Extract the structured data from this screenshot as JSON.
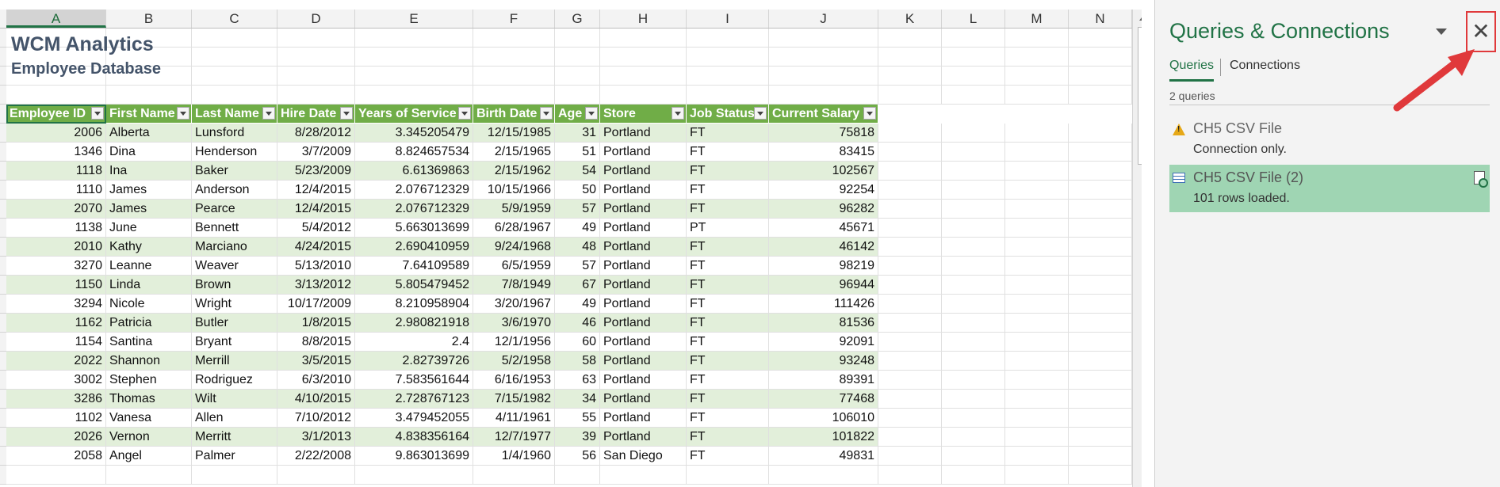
{
  "columns": [
    "A",
    "B",
    "C",
    "D",
    "E",
    "F",
    "G",
    "H",
    "I",
    "J",
    "K",
    "L",
    "M",
    "N"
  ],
  "title": "WCM Analytics",
  "subtitle": "Employee Database",
  "table": {
    "headers": [
      "Employee ID",
      "First Name",
      "Last Name",
      "Hire Date",
      "Years of Service",
      "Birth Date",
      "Age",
      "Store",
      "Job Status",
      "Current Salary"
    ],
    "rows": [
      [
        "2006",
        "Alberta",
        "Lunsford",
        "8/28/2012",
        "3.345205479",
        "12/15/1985",
        "31",
        "Portland",
        "FT",
        "75818"
      ],
      [
        "1346",
        "Dina",
        "Henderson",
        "3/7/2009",
        "8.824657534",
        "2/15/1965",
        "51",
        "Portland",
        "FT",
        "83415"
      ],
      [
        "1118",
        "Ina",
        "Baker",
        "5/23/2009",
        "6.61369863",
        "2/15/1962",
        "54",
        "Portland",
        "FT",
        "102567"
      ],
      [
        "1110",
        "James",
        "Anderson",
        "12/4/2015",
        "2.076712329",
        "10/15/1966",
        "50",
        "Portland",
        "FT",
        "92254"
      ],
      [
        "2070",
        "James",
        "Pearce",
        "12/4/2015",
        "2.076712329",
        "5/9/1959",
        "57",
        "Portland",
        "FT",
        "96282"
      ],
      [
        "1138",
        "June",
        "Bennett",
        "5/4/2012",
        "5.663013699",
        "6/28/1967",
        "49",
        "Portland",
        "PT",
        "45671"
      ],
      [
        "2010",
        "Kathy",
        "Marciano",
        "4/24/2015",
        "2.690410959",
        "9/24/1968",
        "48",
        "Portland",
        "FT",
        "46142"
      ],
      [
        "3270",
        "Leanne",
        "Weaver",
        "5/13/2010",
        "7.64109589",
        "6/5/1959",
        "57",
        "Portland",
        "FT",
        "98219"
      ],
      [
        "1150",
        "Linda",
        "Brown",
        "3/13/2012",
        "5.805479452",
        "7/8/1949",
        "67",
        "Portland",
        "FT",
        "96944"
      ],
      [
        "3294",
        "Nicole",
        "Wright",
        "10/17/2009",
        "8.210958904",
        "3/20/1967",
        "49",
        "Portland",
        "FT",
        "111426"
      ],
      [
        "1162",
        "Patricia",
        "Butler",
        "1/8/2015",
        "2.980821918",
        "3/6/1970",
        "46",
        "Portland",
        "FT",
        "81536"
      ],
      [
        "1154",
        "Santina",
        "Bryant",
        "8/8/2015",
        "2.4",
        "12/1/1956",
        "60",
        "Portland",
        "FT",
        "92091"
      ],
      [
        "2022",
        "Shannon",
        "Merrill",
        "3/5/2015",
        "2.82739726",
        "5/2/1958",
        "58",
        "Portland",
        "FT",
        "93248"
      ],
      [
        "3002",
        "Stephen",
        "Rodriguez",
        "6/3/2010",
        "7.583561644",
        "6/16/1953",
        "63",
        "Portland",
        "FT",
        "89391"
      ],
      [
        "3286",
        "Thomas",
        "Wilt",
        "4/10/2015",
        "2.728767123",
        "7/15/1982",
        "34",
        "Portland",
        "FT",
        "77468"
      ],
      [
        "1102",
        "Vanesa",
        "Allen",
        "7/10/2012",
        "3.479452055",
        "4/11/1961",
        "55",
        "Portland",
        "FT",
        "106010"
      ],
      [
        "2026",
        "Vernon",
        "Merritt",
        "3/1/2013",
        "4.838356164",
        "12/7/1977",
        "39",
        "Portland",
        "FT",
        "101822"
      ],
      [
        "2058",
        "Angel",
        "Palmer",
        "2/22/2008",
        "9.863013699",
        "1/4/1960",
        "56",
        "San Diego",
        "FT",
        "49831"
      ]
    ]
  },
  "pane": {
    "title": "Queries & Connections",
    "close_label": "✕",
    "tab_queries": "Queries",
    "tab_connections": "Connections",
    "query_count": "2 queries",
    "queries": [
      {
        "name": "CH5 CSV File",
        "status": "Connection only."
      },
      {
        "name": "CH5 CSV File (2)",
        "status": "101 rows loaded."
      }
    ]
  },
  "colors": {
    "header_green": "#70ad47",
    "band_green": "#e2efda",
    "excel_green": "#217346",
    "title_blue_gray": "#44546a",
    "selected_query": "#9fd5b3",
    "annotation_red": "#e0393b"
  }
}
